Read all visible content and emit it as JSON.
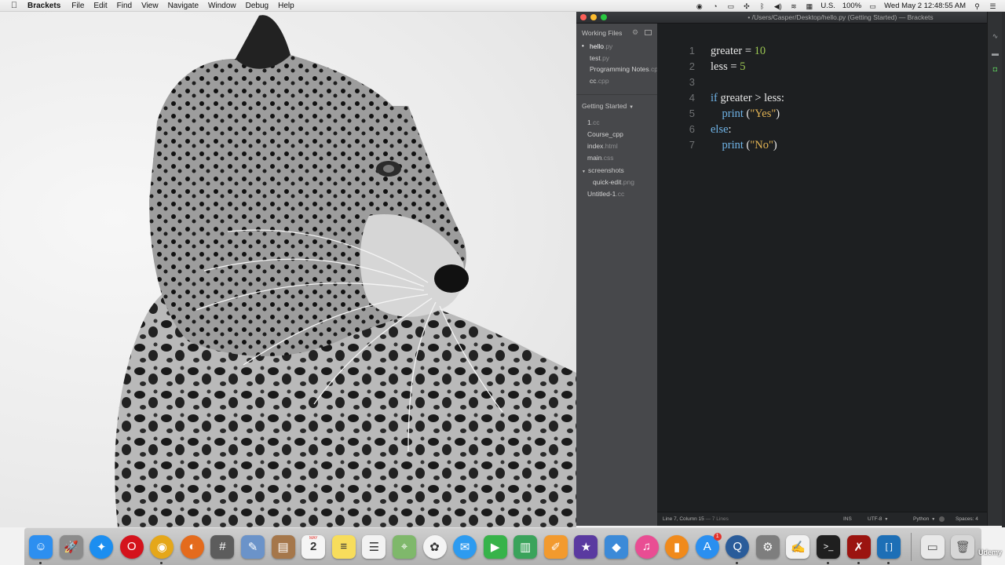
{
  "menubar": {
    "apple_icon": "apple-icon",
    "app_name": "Brackets",
    "menus": [
      "File",
      "Edit",
      "Find",
      "View",
      "Navigate",
      "Window",
      "Debug",
      "Help"
    ],
    "input_source": "U.S.",
    "battery": "100%",
    "clock": "Wed May 2  12:48:55 AM"
  },
  "window": {
    "title": "• /Users/Casper/Desktop/hello.py (Getting Started) — Brackets"
  },
  "sidebar": {
    "working_files_label": "Working Files",
    "working_files": [
      {
        "name": "hello",
        "ext": ".py"
      },
      {
        "name": "test",
        "ext": ".py"
      },
      {
        "name": "Programming Notes",
        "ext": ".cp"
      },
      {
        "name": "cc",
        "ext": ".cpp"
      }
    ],
    "project_label": "Getting Started",
    "tree": [
      {
        "name": "1",
        "ext": ".cc"
      },
      {
        "name": "Course_cpp",
        "ext": ""
      },
      {
        "name": "index",
        "ext": ".html"
      },
      {
        "name": "main",
        "ext": ".css"
      },
      {
        "name": "screenshots",
        "ext": ""
      },
      {
        "name": "quick-edit",
        "ext": ".png"
      },
      {
        "name": "Untitled-1",
        "ext": ".cc"
      }
    ]
  },
  "editor": {
    "lines": [
      {
        "n": "1",
        "t": [
          {
            "c": "plain",
            "v": "greater = "
          },
          {
            "c": "num",
            "v": "10"
          }
        ]
      },
      {
        "n": "2",
        "t": [
          {
            "c": "plain",
            "v": "less = "
          },
          {
            "c": "num",
            "v": "5"
          }
        ]
      },
      {
        "n": "3",
        "t": []
      },
      {
        "n": "4",
        "t": [
          {
            "c": "kw",
            "v": "if"
          },
          {
            "c": "plain",
            "v": " greater > less:"
          }
        ]
      },
      {
        "n": "5",
        "t": [
          {
            "c": "plain",
            "v": "    "
          },
          {
            "c": "fn",
            "v": "print"
          },
          {
            "c": "plain",
            "v": " ("
          },
          {
            "c": "str",
            "v": "\"Yes\""
          },
          {
            "c": "plain",
            "v": ")"
          }
        ]
      },
      {
        "n": "6",
        "t": [
          {
            "c": "kw",
            "v": "else"
          },
          {
            "c": "plain",
            "v": ":"
          }
        ]
      },
      {
        "n": "7",
        "t": [
          {
            "c": "plain",
            "v": "    "
          },
          {
            "c": "fn",
            "v": "print"
          },
          {
            "c": "plain",
            "v": " ("
          },
          {
            "c": "str",
            "v": "\"No\""
          },
          {
            "c": "plain",
            "v": ")"
          }
        ]
      }
    ]
  },
  "statusbar": {
    "position": "Line 7, Column 15",
    "lines_count": "— 7 Lines",
    "mode": "INS",
    "encoding": "UTF-8",
    "language": "Python",
    "spaces": "Spaces: 4"
  },
  "dock": {
    "apps": [
      {
        "name": "finder",
        "glyph": "☺",
        "bg": "#2d8ff0",
        "running": true
      },
      {
        "name": "launchpad",
        "glyph": "🚀",
        "bg": "#8c8c8c",
        "running": false
      },
      {
        "name": "safari",
        "glyph": "✦",
        "bg": "#1c8ef0",
        "running": false
      },
      {
        "name": "opera",
        "glyph": "O",
        "bg": "#d4131c",
        "running": false
      },
      {
        "name": "chrome",
        "glyph": "◉",
        "bg": "#e5a71a",
        "running": true
      },
      {
        "name": "firefox",
        "glyph": "◐",
        "bg": "#e46b1d",
        "running": false
      },
      {
        "name": "calculator",
        "glyph": "#",
        "bg": "#5c5c5c",
        "running": false
      },
      {
        "name": "preview",
        "glyph": "✎",
        "bg": "#6b93c9",
        "running": false
      },
      {
        "name": "contacts",
        "glyph": "▤",
        "bg": "#a5774b",
        "running": false
      },
      {
        "name": "calendar",
        "glyph": "2",
        "bg": "#f5f5f5",
        "running": false
      },
      {
        "name": "notes",
        "glyph": "≡",
        "bg": "#f7dd5c",
        "running": false
      },
      {
        "name": "reminders",
        "glyph": "☰",
        "bg": "#f2f2f2",
        "running": false
      },
      {
        "name": "maps",
        "glyph": "⌖",
        "bg": "#7fb86b",
        "running": false
      },
      {
        "name": "photos",
        "glyph": "✿",
        "bg": "#f4f4f4",
        "running": false
      },
      {
        "name": "messages",
        "glyph": "✉",
        "bg": "#2d9bf0",
        "running": false
      },
      {
        "name": "facetime",
        "glyph": "▶",
        "bg": "#37b34a",
        "running": false
      },
      {
        "name": "numbers",
        "glyph": "▥",
        "bg": "#3aa35b",
        "running": false
      },
      {
        "name": "pages",
        "glyph": "✐",
        "bg": "#f29a2e",
        "running": false
      },
      {
        "name": "imovie",
        "glyph": "★",
        "bg": "#5a3aa0",
        "running": false
      },
      {
        "name": "keynote",
        "glyph": "◆",
        "bg": "#3c8ad8",
        "running": false
      },
      {
        "name": "itunes",
        "glyph": "♫",
        "bg": "#e94d93",
        "running": false
      },
      {
        "name": "ibooks",
        "glyph": "▮",
        "bg": "#f08a1c",
        "running": false
      },
      {
        "name": "app-store",
        "glyph": "A",
        "bg": "#2a8ff0",
        "running": false
      },
      {
        "name": "quicktime",
        "glyph": "Q",
        "bg": "#2a5c9a",
        "running": true
      },
      {
        "name": "system-preferences",
        "glyph": "⚙",
        "bg": "#7e7e7e",
        "running": false
      },
      {
        "name": "textedit",
        "glyph": "✍",
        "bg": "#f1f1f1",
        "running": false
      },
      {
        "name": "terminal",
        "glyph": ">_",
        "bg": "#1f1f1f",
        "running": true
      },
      {
        "name": "acrobat",
        "glyph": "✗",
        "bg": "#9b1410",
        "running": true
      },
      {
        "name": "brackets",
        "glyph": "[ ]",
        "bg": "#1d6fb6",
        "running": true
      }
    ],
    "app_store_badge": "1",
    "calendar_month": "MAY",
    "trash_items": [
      {
        "name": "downloads-stack",
        "glyph": "▭",
        "bg": "#e9e9e9"
      },
      {
        "name": "trash",
        "glyph": "🗑",
        "bg": "#d7d7d7"
      }
    ]
  },
  "watermark": "Udemy"
}
